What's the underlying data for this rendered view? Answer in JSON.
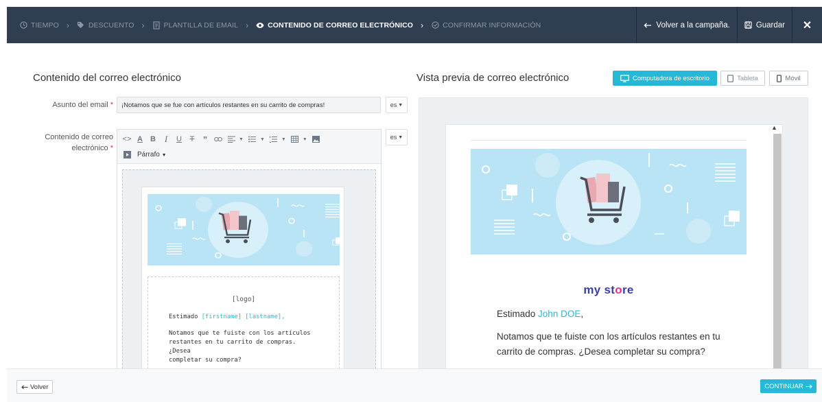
{
  "steps": [
    {
      "label": "TIEMPO",
      "icon": "clock-icon"
    },
    {
      "label": "DESCUENTO",
      "icon": "tag-icon"
    },
    {
      "label": "PLANTILLA DE EMAIL",
      "icon": "document-icon"
    },
    {
      "label": "CONTENIDO DE CORREO ELECTRÓNICO",
      "icon": "eye-icon"
    },
    {
      "label": "CONFIRMAR INFORMACIÓN",
      "icon": "check-circle-icon"
    }
  ],
  "header": {
    "back_campaign": "Volver a la campaña.",
    "save": "Guardar",
    "close": "✕"
  },
  "left": {
    "title": "Contenido del correo electrónico",
    "subject_label": "Asunto del email",
    "subject_value": "¡Notamos que se fue con artículos restantes en su carrito de compras!",
    "content_label_1": "Contenido de correo",
    "content_label_2": "electrónico",
    "lang": "es",
    "paragraph": "Párrafo"
  },
  "editor_mail": {
    "logo": "[logo]",
    "greeting_prefix": "Estimado",
    "firstname": "[firstname]",
    "lastname": "[lastname],",
    "body_1": "Notamos que te fuiste con los artículos",
    "body_2": "restantes en tu carrito de compras. ¿Desea",
    "body_3": "completar su compra?"
  },
  "right": {
    "title": "Vista previa de correo electrónico",
    "desktop": "Computadora de escritorio",
    "tablet": "Tableta",
    "mobile": "Móvil"
  },
  "preview_mail": {
    "brand_1": "my st",
    "brand_2": "o",
    "brand_3": "re",
    "greeting_prefix": "Estimado",
    "name": "John DOE",
    "greeting_suffix": ",",
    "body_1": "Notamos que te fuiste con los artículos restantes en tu",
    "body_2": "carrito de compras. ¿Desea completar su compra?"
  },
  "footer": {
    "back": "Volver",
    "continue": "CONTINUAR"
  },
  "colors": {
    "topbar": "#2f3e50",
    "accent": "#25b9d7",
    "banner": "#b9e4f5",
    "required": "#e0245e"
  }
}
